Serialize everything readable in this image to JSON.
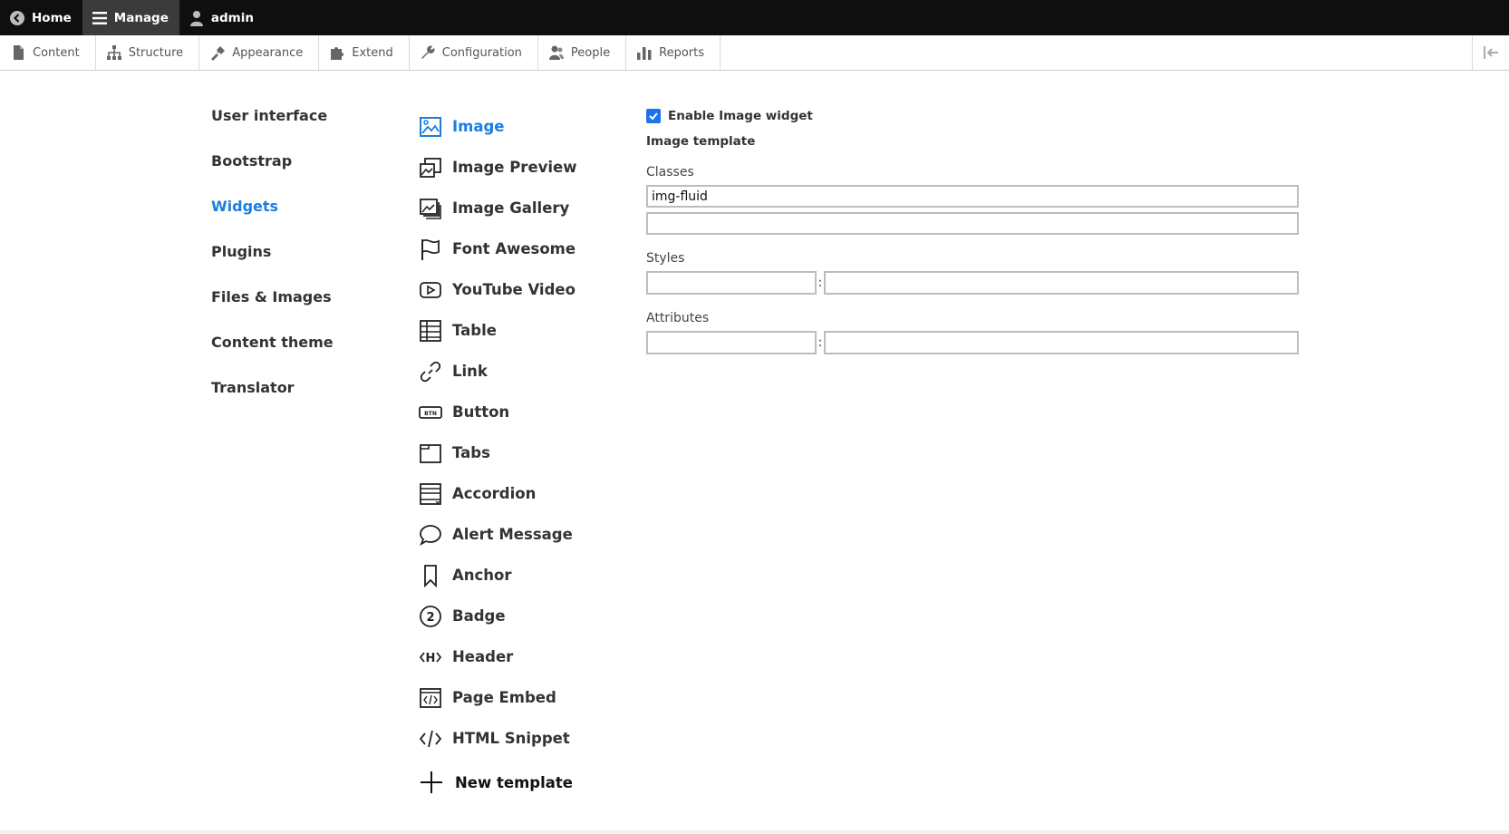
{
  "toolbar": {
    "home_label": "Home",
    "manage_label": "Manage",
    "user_label": "admin"
  },
  "tray": {
    "items": [
      {
        "label": "Content",
        "icon": "file-icon"
      },
      {
        "label": "Structure",
        "icon": "sitemap-icon"
      },
      {
        "label": "Appearance",
        "icon": "paintbrush-icon"
      },
      {
        "label": "Extend",
        "icon": "puzzle-icon"
      },
      {
        "label": "Configuration",
        "icon": "wrench-icon"
      },
      {
        "label": "People",
        "icon": "people-icon"
      },
      {
        "label": "Reports",
        "icon": "bar-chart-icon"
      }
    ]
  },
  "left_nav": {
    "items": [
      {
        "label": "User interface"
      },
      {
        "label": "Bootstrap"
      },
      {
        "label": "Widgets",
        "active": true
      },
      {
        "label": "Plugins"
      },
      {
        "label": "Files & Images"
      },
      {
        "label": "Content theme"
      },
      {
        "label": "Translator"
      }
    ]
  },
  "widgets": {
    "items": [
      {
        "label": "Image",
        "icon": "image-icon",
        "active": true
      },
      {
        "label": "Image Preview",
        "icon": "image-preview-icon"
      },
      {
        "label": "Image Gallery",
        "icon": "image-gallery-icon"
      },
      {
        "label": "Font Awesome",
        "icon": "flag-icon"
      },
      {
        "label": "YouTube Video",
        "icon": "play-icon"
      },
      {
        "label": "Table",
        "icon": "table-icon"
      },
      {
        "label": "Link",
        "icon": "link-icon"
      },
      {
        "label": "Button",
        "icon": "button-icon"
      },
      {
        "label": "Tabs",
        "icon": "tabs-icon"
      },
      {
        "label": "Accordion",
        "icon": "accordion-icon"
      },
      {
        "label": "Alert Message",
        "icon": "speech-bubble-icon"
      },
      {
        "label": "Anchor",
        "icon": "bookmark-icon"
      },
      {
        "label": "Badge",
        "icon": "badge-icon"
      },
      {
        "label": "Header",
        "icon": "header-icon"
      },
      {
        "label": "Page Embed",
        "icon": "page-embed-icon"
      },
      {
        "label": "HTML Snippet",
        "icon": "code-icon"
      }
    ],
    "new_template_label": "New template",
    "button_icon_text": "BTN",
    "header_icon_text": "H",
    "badge_icon_text": "2"
  },
  "form": {
    "enable_label": "Enable Image widget",
    "enable_checked": true,
    "template_heading": "Image template",
    "classes_label": "Classes",
    "classes_values": [
      "img-fluid",
      ""
    ],
    "styles_label": "Styles",
    "styles_key": "",
    "styles_value": "",
    "attributes_label": "Attributes",
    "attributes_key": "",
    "attributes_value": "",
    "pair_separator": ":"
  },
  "colors": {
    "accent": "#1a7fe0",
    "toolbar_bg": "#0f0f0f",
    "toolbar_active": "#3b3b3b",
    "checkbox": "#1a73e8"
  }
}
